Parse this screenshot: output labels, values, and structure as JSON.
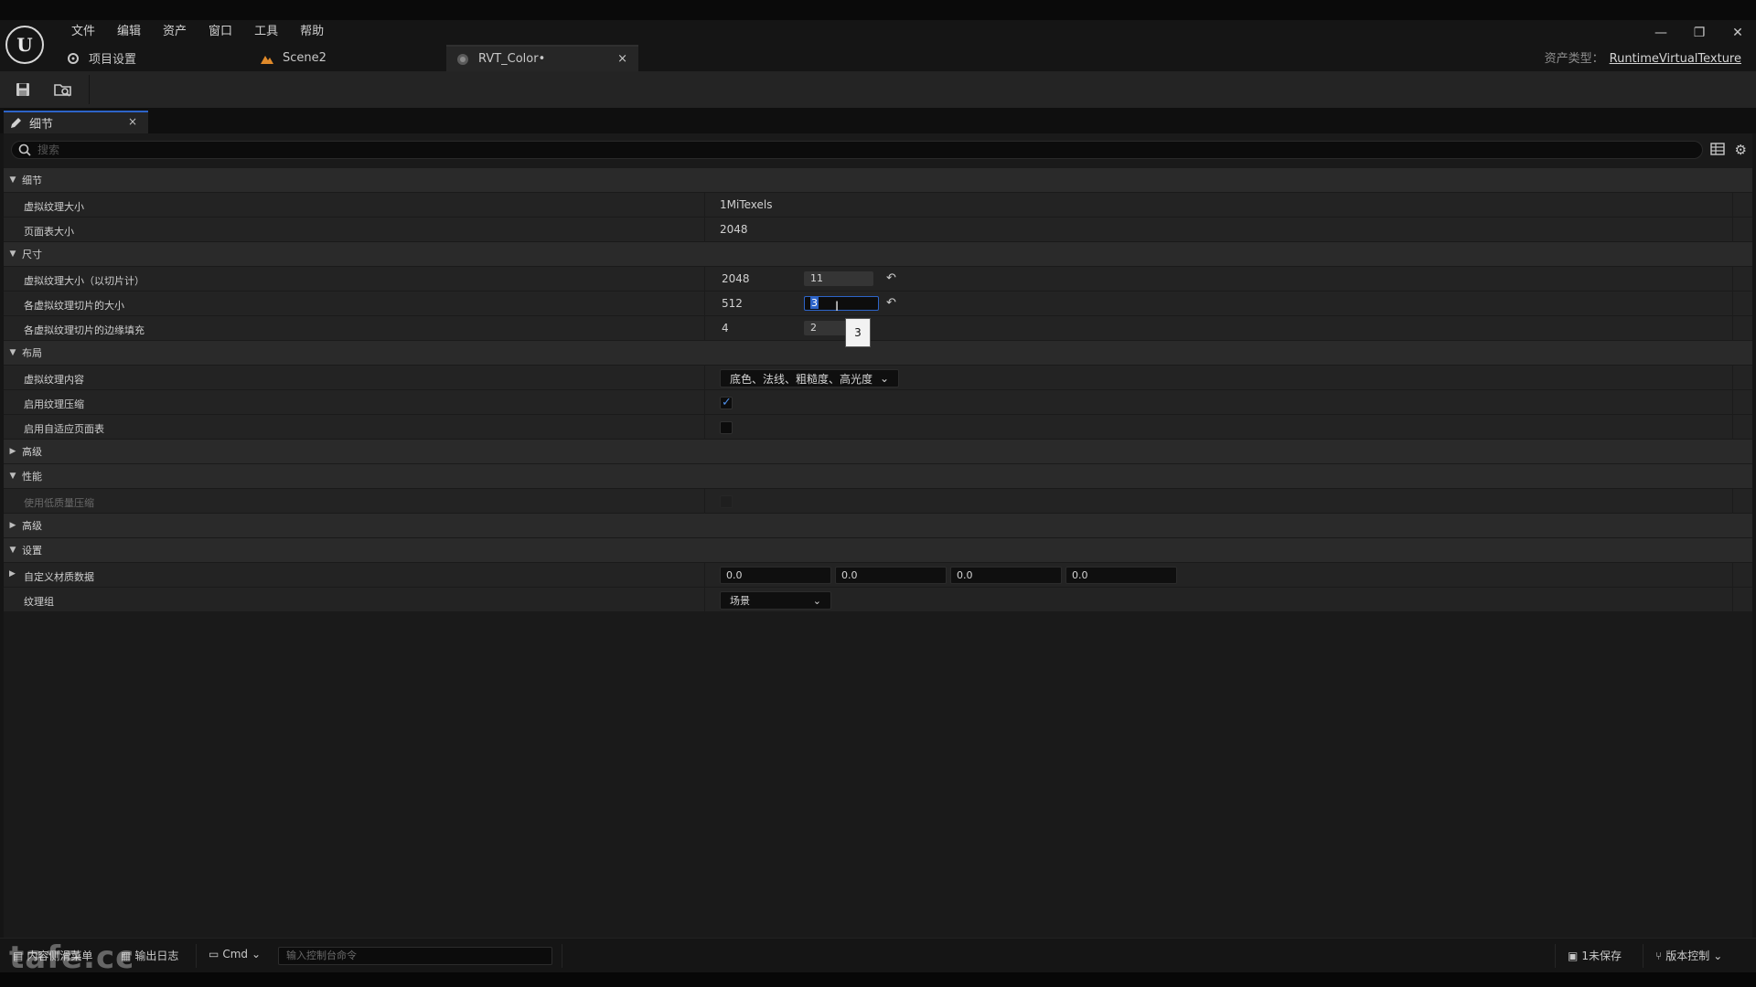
{
  "menu": [
    "文件",
    "编辑",
    "资产",
    "窗口",
    "工具",
    "帮助"
  ],
  "tabs": [
    {
      "label": "项目设置"
    },
    {
      "label": "Scene2"
    },
    {
      "label": "RVT_Color•",
      "close": "×"
    }
  ],
  "window": {
    "minimize": "—",
    "restore": "❐",
    "close": "✕"
  },
  "asset_type": {
    "label": "资产类型：",
    "value": "RuntimeVirtualTexture"
  },
  "panel": {
    "title": "细节",
    "close": "×"
  },
  "search": {
    "placeholder": "搜索"
  },
  "sections": {
    "details": {
      "label": "细节"
    },
    "size": {
      "label": "尺寸"
    },
    "layout": {
      "label": "布局"
    },
    "advanced1": {
      "label": "高级"
    },
    "performance": {
      "label": "性能"
    },
    "advanced2": {
      "label": "高级"
    },
    "settings": {
      "label": "设置"
    }
  },
  "props": {
    "virtual_texture_size": {
      "name": "虚拟纹理大小",
      "value": "1MiTexels"
    },
    "page_table_size": {
      "name": "页面表大小",
      "value": "2048"
    },
    "size_in_tiles": {
      "name": "虚拟纹理大小（以切片计）",
      "value": "2048",
      "field": "11"
    },
    "tile_size": {
      "name": "各虚拟纹理切片的大小",
      "value": "512",
      "field": "3"
    },
    "tile_border": {
      "name": "各虚拟纹理切片的边缘填充",
      "value": "4",
      "field": "2"
    },
    "content": {
      "name": "虚拟纹理内容",
      "value": "底色、法线、粗糙度、高光度"
    },
    "compression": {
      "name": "启用纹理压缩",
      "checked": true
    },
    "adaptive_page_table": {
      "name": "启用自适应页面表",
      "checked": false
    },
    "low_quality_compression": {
      "name": "使用低质量压缩",
      "checked": false
    },
    "custom_material_data": {
      "name": "自定义材质数据",
      "values": [
        "0.0",
        "0.0",
        "0.0",
        "0.0"
      ]
    },
    "texture_group": {
      "name": "纹理组",
      "value": "场景"
    }
  },
  "tooltip": "3",
  "status": {
    "content_drawer": "内容侧滑菜单",
    "output_log": "输出日志",
    "cmd": "Cmd",
    "console_placeholder": "输入控制台命令",
    "unsaved": "1未保存",
    "source_control": "版本控制"
  },
  "watermark": "tafe.cc"
}
